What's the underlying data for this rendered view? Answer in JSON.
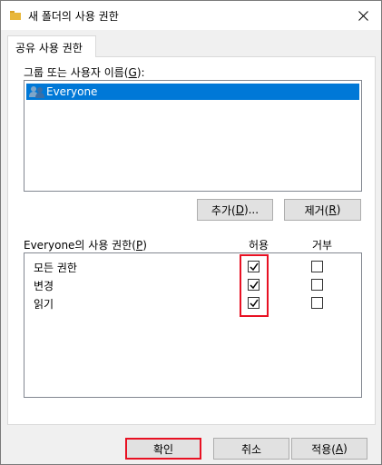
{
  "window": {
    "title": "새 폴더의 사용 권한"
  },
  "tab": {
    "label": "공유 사용 권한"
  },
  "group_section": {
    "label_prefix": "그룹 또는 사용자 이름(",
    "label_key": "G",
    "label_suffix": "):",
    "items": [
      {
        "name": "Everyone",
        "icon": "users-icon",
        "selected": true
      }
    ]
  },
  "buttons": {
    "add_prefix": "추가(",
    "add_key": "D",
    "add_suffix": ")...",
    "remove_prefix": "제거(",
    "remove_key": "R",
    "remove_suffix": ")"
  },
  "permissions": {
    "label_prefix": "Everyone의 사용 권한(",
    "label_key": "P",
    "label_suffix": ")",
    "allow_header": "허용",
    "deny_header": "거부",
    "rows": [
      {
        "name": "모든 권한",
        "allow": true,
        "deny": false
      },
      {
        "name": "변경",
        "allow": true,
        "deny": false
      },
      {
        "name": "읽기",
        "allow": true,
        "deny": false
      }
    ]
  },
  "footer": {
    "ok": "확인",
    "cancel": "취소",
    "apply_prefix": "적용(",
    "apply_key": "A",
    "apply_suffix": ")"
  },
  "colors": {
    "selection": "#0078d7",
    "highlight": "#e81123",
    "folder": "#e8b73b"
  }
}
